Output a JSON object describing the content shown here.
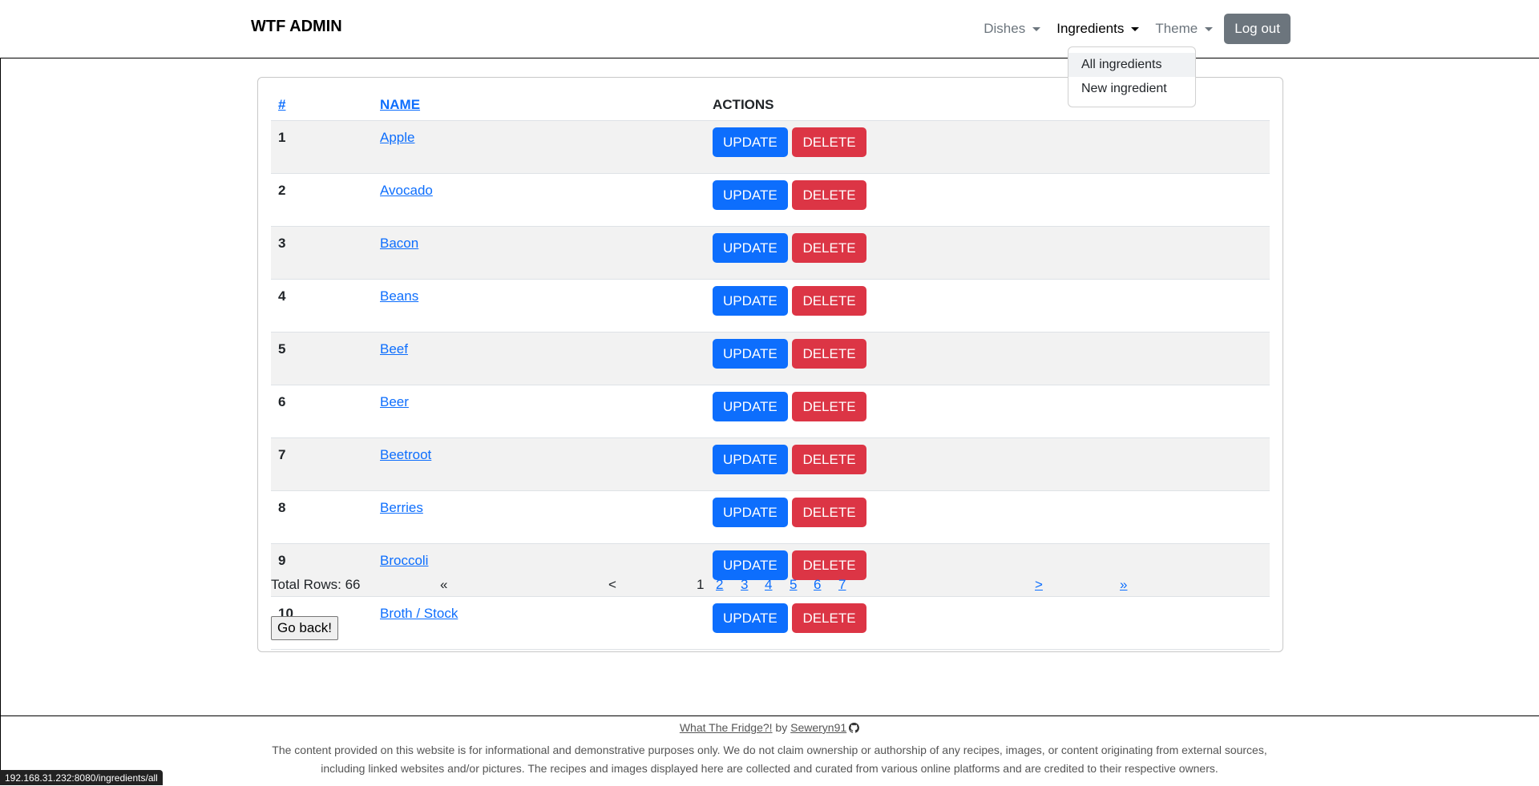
{
  "navbar": {
    "brand": "WTF ADMIN",
    "items": [
      {
        "label": "Dishes"
      },
      {
        "label": "Ingredients"
      },
      {
        "label": "Theme"
      }
    ],
    "logout_label": "Log out"
  },
  "dropdown": {
    "items": [
      "All ingredients",
      "New ingredient"
    ]
  },
  "table": {
    "headers": {
      "num": "#",
      "name": "NAME",
      "actions": "ACTIONS"
    },
    "update_label": "UPDATE",
    "delete_label": "DELETE",
    "rows": [
      {
        "id": "1",
        "name": "Apple"
      },
      {
        "id": "2",
        "name": "Avocado"
      },
      {
        "id": "3",
        "name": "Bacon"
      },
      {
        "id": "4",
        "name": "Beans"
      },
      {
        "id": "5",
        "name": "Beef"
      },
      {
        "id": "6",
        "name": "Beer"
      },
      {
        "id": "7",
        "name": "Beetroot"
      },
      {
        "id": "8",
        "name": "Berries"
      },
      {
        "id": "9",
        "name": "Broccoli"
      },
      {
        "id": "10",
        "name": "Broth / Stock"
      }
    ]
  },
  "pager": {
    "total_rows": "Total Rows: 66",
    "first": "«",
    "prev": "<",
    "current": "1",
    "pages": [
      "2",
      "3",
      "4",
      "5",
      "6",
      "7"
    ],
    "next": ">",
    "last": "»"
  },
  "go_back_label": "Go back!",
  "footer": {
    "site_link": "What The Fridge?!",
    "by": "by",
    "author_link": "Seweryn91",
    "disclaimer_line1": "The content provided on this website is for informational and demonstrative purposes only. We do not claim ownership or authorship of any recipes, images, or content originating from external sources,",
    "disclaimer_line2": "including linked websites and/or pictures. The recipes and images displayed here are collected and curated from various online platforms and are credited to their respective owners."
  },
  "status_url": "192.168.31.232:8080/ingredients/all",
  "colors": {
    "primary": "#0d6efd",
    "danger": "#dc3545",
    "secondary": "#6c757d"
  }
}
